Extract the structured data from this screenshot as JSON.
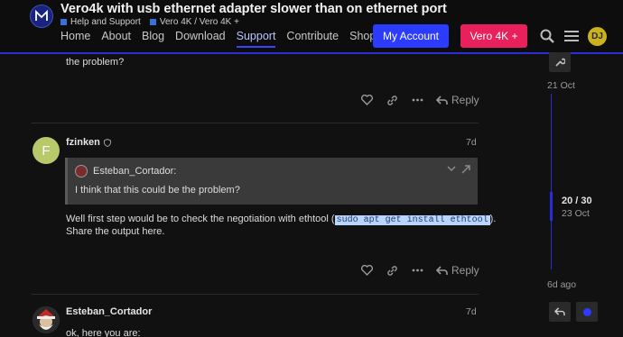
{
  "header": {
    "title": "Vero4k with usb ethernet adapter slower than on ethernet port",
    "crumbs": [
      "Help and Support",
      "Vero 4K / Vero 4K +"
    ],
    "nav": [
      "Home",
      "About",
      "Blog",
      "Download",
      "Support",
      "Contribute",
      "Shop"
    ],
    "active_nav": "Support",
    "account_button": "My Account",
    "vero_button": "Vero 4K +",
    "user_initials": "DJ",
    "accent": "#2c3cff",
    "brand_pink": "#e8205b"
  },
  "post_prev": {
    "text_tail": "the problem?",
    "reply_label": "Reply"
  },
  "post_fzinken": {
    "avatar_letter": "F",
    "avatar_color": "#b7c96a",
    "username": "fzinken",
    "date": "7d",
    "quote_author": "Esteban_Cortador:",
    "quote_text": "I think that this could be the problem?",
    "body_before": "Well first step would be to check the negotiation with ethtool (",
    "body_code": "sudo apt get install ethtool",
    "body_after": ").",
    "body_line2": "Share the output here.",
    "reply_label": "Reply"
  },
  "post_esteban": {
    "username": "Esteban_Cortador",
    "date": "7d",
    "text": "ok, here you are:"
  },
  "timeline": {
    "top_date": "21 Oct",
    "position": "20 / 30",
    "position_date": "23 Oct",
    "bottom_date": "6d ago"
  }
}
